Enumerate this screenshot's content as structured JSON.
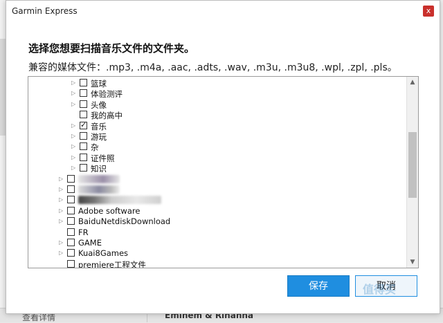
{
  "dialog": {
    "title": "Garmin Express",
    "close_label": "x",
    "heading": "选择您想要扫描音乐文件的文件夹。",
    "subheading": "兼容的媒体文件：.mp3, .m4a, .aac, .adts, .wav, .m3u, .m3u8, .wpl, .zpl, .pls。",
    "save_label": "保存",
    "cancel_label": "取消"
  },
  "tree": {
    "sub_items": [
      {
        "label": "篮球",
        "checked": false,
        "expandable": true
      },
      {
        "label": "体验测评",
        "checked": false,
        "expandable": true
      },
      {
        "label": "头像",
        "checked": false,
        "expandable": true
      },
      {
        "label": "我的高中",
        "checked": false,
        "expandable": false
      },
      {
        "label": "音乐",
        "checked": true,
        "expandable": true
      },
      {
        "label": "游玩",
        "checked": false,
        "expandable": true
      },
      {
        "label": "杂",
        "checked": false,
        "expandable": true
      },
      {
        "label": "证件照",
        "checked": false,
        "expandable": true
      },
      {
        "label": "知识",
        "checked": false,
        "expandable": true
      }
    ],
    "top_items": [
      {
        "label": "",
        "checked": false,
        "expandable": true,
        "redacted": true
      },
      {
        "label": "",
        "checked": false,
        "expandable": true,
        "redacted": true
      },
      {
        "label": "",
        "checked": false,
        "expandable": true,
        "redacted": true
      },
      {
        "label": "Adobe software",
        "checked": false,
        "expandable": true
      },
      {
        "label": "BaiduNetdiskDownload",
        "checked": false,
        "expandable": true
      },
      {
        "label": "FR",
        "checked": false,
        "expandable": false
      },
      {
        "label": "GAME",
        "checked": false,
        "expandable": true
      },
      {
        "label": "Kuai8Games",
        "checked": false,
        "expandable": true
      },
      {
        "label": "premiere工程文件",
        "checked": false,
        "expandable": false
      }
    ]
  },
  "background": {
    "left_text": "查看详情",
    "right_text": "Eminem & Rihanna"
  },
  "watermark": "值得买",
  "colors": {
    "accent": "#1f8ee0",
    "close": "#c9302c"
  }
}
